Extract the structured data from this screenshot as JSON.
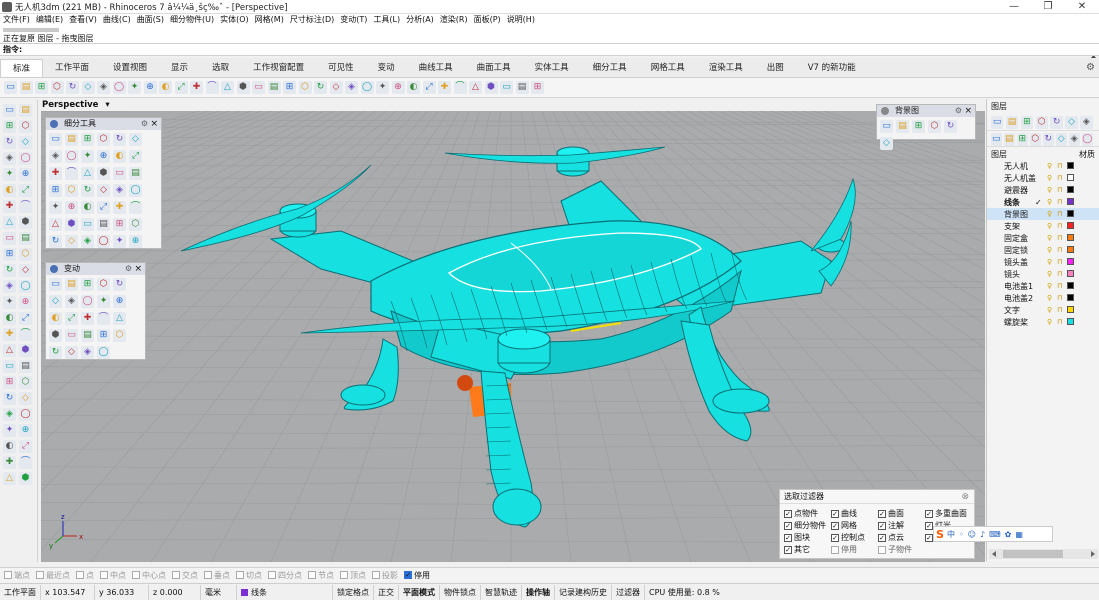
{
  "window": {
    "title": "无人机3dm (221 MB) - Rhinoceros 7 â¼¼ä¸šç‰ˆ - [Perspective]",
    "controls": [
      "—",
      "❐",
      "✕"
    ]
  },
  "menu": [
    "文件(F)",
    "编辑(E)",
    "查看(V)",
    "曲线(C)",
    "曲面(S)",
    "细分物件(U)",
    "实体(O)",
    "网格(M)",
    "尺寸标注(D)",
    "变动(T)",
    "工具(L)",
    "分析(A)",
    "渲染(R)",
    "面板(P)",
    "说明(H)"
  ],
  "command_history": {
    "line1": "正在复原 图层 - 拖曳图层"
  },
  "command_prompt": "指令:",
  "tabs": [
    "标准",
    "工作平面",
    "设置视图",
    "显示",
    "选取",
    "工作视窗配置",
    "可见性",
    "变动",
    "曲线工具",
    "曲面工具",
    "实体工具",
    "细分工具",
    "网格工具",
    "渲染工具",
    "出图",
    "V7 的新功能"
  ],
  "active_tab": "标准",
  "viewport": {
    "label": "Perspective",
    "label_arrow": "▾",
    "background": "#a9abad",
    "grid_color": "#9a9c9e",
    "model_color": "#16e0e0",
    "model_edge": "#0b6f75",
    "accent_orange": "#ff7a1a",
    "axis": {
      "x": "x",
      "y": "y",
      "z": "z"
    }
  },
  "panels": {
    "subd_tools": {
      "title": "细分工具"
    },
    "transform": {
      "title": "变动"
    },
    "background_bitmap": {
      "title": "背景图"
    }
  },
  "layers_panel": {
    "title": "图层",
    "col_layer": "图层",
    "col_material": "材质",
    "layers": [
      {
        "name": "无人机",
        "color": "#000000"
      },
      {
        "name": "无人机盖",
        "color": "#ffffff"
      },
      {
        "name": "避震器",
        "color": "#000000"
      },
      {
        "name": "线条",
        "color": "#7a2fd0",
        "bold": true,
        "current": true
      },
      {
        "name": "背景图",
        "color": "#000000",
        "selected": true
      },
      {
        "name": "支架",
        "color": "#ff2020"
      },
      {
        "name": "固定盒",
        "color": "#ff7a10"
      },
      {
        "name": "固定锁",
        "color": "#ff7a10"
      },
      {
        "name": "镜头盖",
        "color": "#ff20ff"
      },
      {
        "name": "镜头",
        "color": "#ff80c0"
      },
      {
        "name": "电池盖1",
        "color": "#000000"
      },
      {
        "name": "电池盖2",
        "color": "#000000"
      },
      {
        "name": "文字",
        "color": "#ffd700"
      },
      {
        "name": "螺旋桨",
        "color": "#16e0e0"
      }
    ]
  },
  "selection_filter": {
    "title": "选取过滤器",
    "items": [
      {
        "label": "点物件",
        "checked": true
      },
      {
        "label": "曲线",
        "checked": true
      },
      {
        "label": "曲面",
        "checked": true
      },
      {
        "label": "多重曲面",
        "checked": true
      },
      {
        "label": "细分物件",
        "checked": true
      },
      {
        "label": "网格",
        "checked": true
      },
      {
        "label": "注解",
        "checked": true
      },
      {
        "label": "灯光",
        "checked": true
      },
      {
        "label": "图块",
        "checked": true
      },
      {
        "label": "控制点",
        "checked": true
      },
      {
        "label": "点云",
        "checked": true
      },
      {
        "label": "剖面",
        "checked": true
      },
      {
        "label": "其它",
        "checked": true
      },
      {
        "label": "停用",
        "checked": false
      },
      {
        "label": "子物件",
        "checked": false
      }
    ]
  },
  "osnap": [
    {
      "label": "端点",
      "on": false
    },
    {
      "label": "最近点",
      "on": false
    },
    {
      "label": "点",
      "on": false
    },
    {
      "label": "中点",
      "on": false
    },
    {
      "label": "中心点",
      "on": false
    },
    {
      "label": "交点",
      "on": false
    },
    {
      "label": "垂点",
      "on": false
    },
    {
      "label": "切点",
      "on": false
    },
    {
      "label": "四分点",
      "on": false
    },
    {
      "label": "节点",
      "on": false
    },
    {
      "label": "顶点",
      "on": false
    },
    {
      "label": "投影",
      "on": false
    },
    {
      "label": "停用",
      "on": true
    }
  ],
  "status": {
    "cplane": "工作平面",
    "x": "x 103.547",
    "y": "y 36.033",
    "z": "z 0.000",
    "units": "毫米",
    "layer": "线条",
    "items": [
      "锁定格点",
      "正交",
      "平面模式",
      "物件锁点",
      "智慧轨迹",
      "操作轴",
      "记录建构历史",
      "过滤器"
    ],
    "bold_items": [
      "平面模式",
      "操作轴"
    ],
    "cpu": "CPU 使用量: 0.8 %"
  },
  "ime": {
    "logo": "S",
    "mode": "中"
  }
}
